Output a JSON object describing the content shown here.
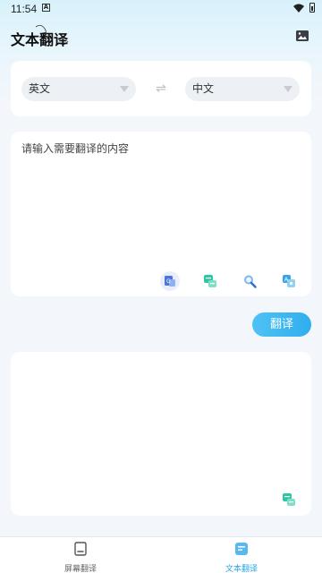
{
  "status_bar": {
    "time": "11:54",
    "notification_icon": "A"
  },
  "header": {
    "title": "文本翻译",
    "image_icon": "image-icon"
  },
  "languages": {
    "source": "英文",
    "target": "中文",
    "swap_icon": "swap-icon"
  },
  "input": {
    "placeholder": "请输入需要翻译的内容",
    "value": ""
  },
  "tools": [
    {
      "name": "text-recognition-icon",
      "color": "#5b7fdb"
    },
    {
      "name": "copy-icon",
      "color": "#31c7a8"
    },
    {
      "name": "search-icon",
      "color": "#3a8ee6"
    },
    {
      "name": "photo-translate-icon",
      "color": "#3aa8e0"
    }
  ],
  "translate_button": {
    "label": "翻译"
  },
  "output": {
    "value": "",
    "copy_icon": "copy-icon"
  },
  "bottom_nav": {
    "items": [
      {
        "label": "屏幕翻译",
        "icon": "screen-icon",
        "active": false
      },
      {
        "label": "文本翻译",
        "icon": "document-icon",
        "active": true
      }
    ]
  },
  "colors": {
    "accent": "#30aeee",
    "background": "#f3f6fa",
    "card": "#ffffff",
    "active_tab": "#2aa6e8"
  }
}
